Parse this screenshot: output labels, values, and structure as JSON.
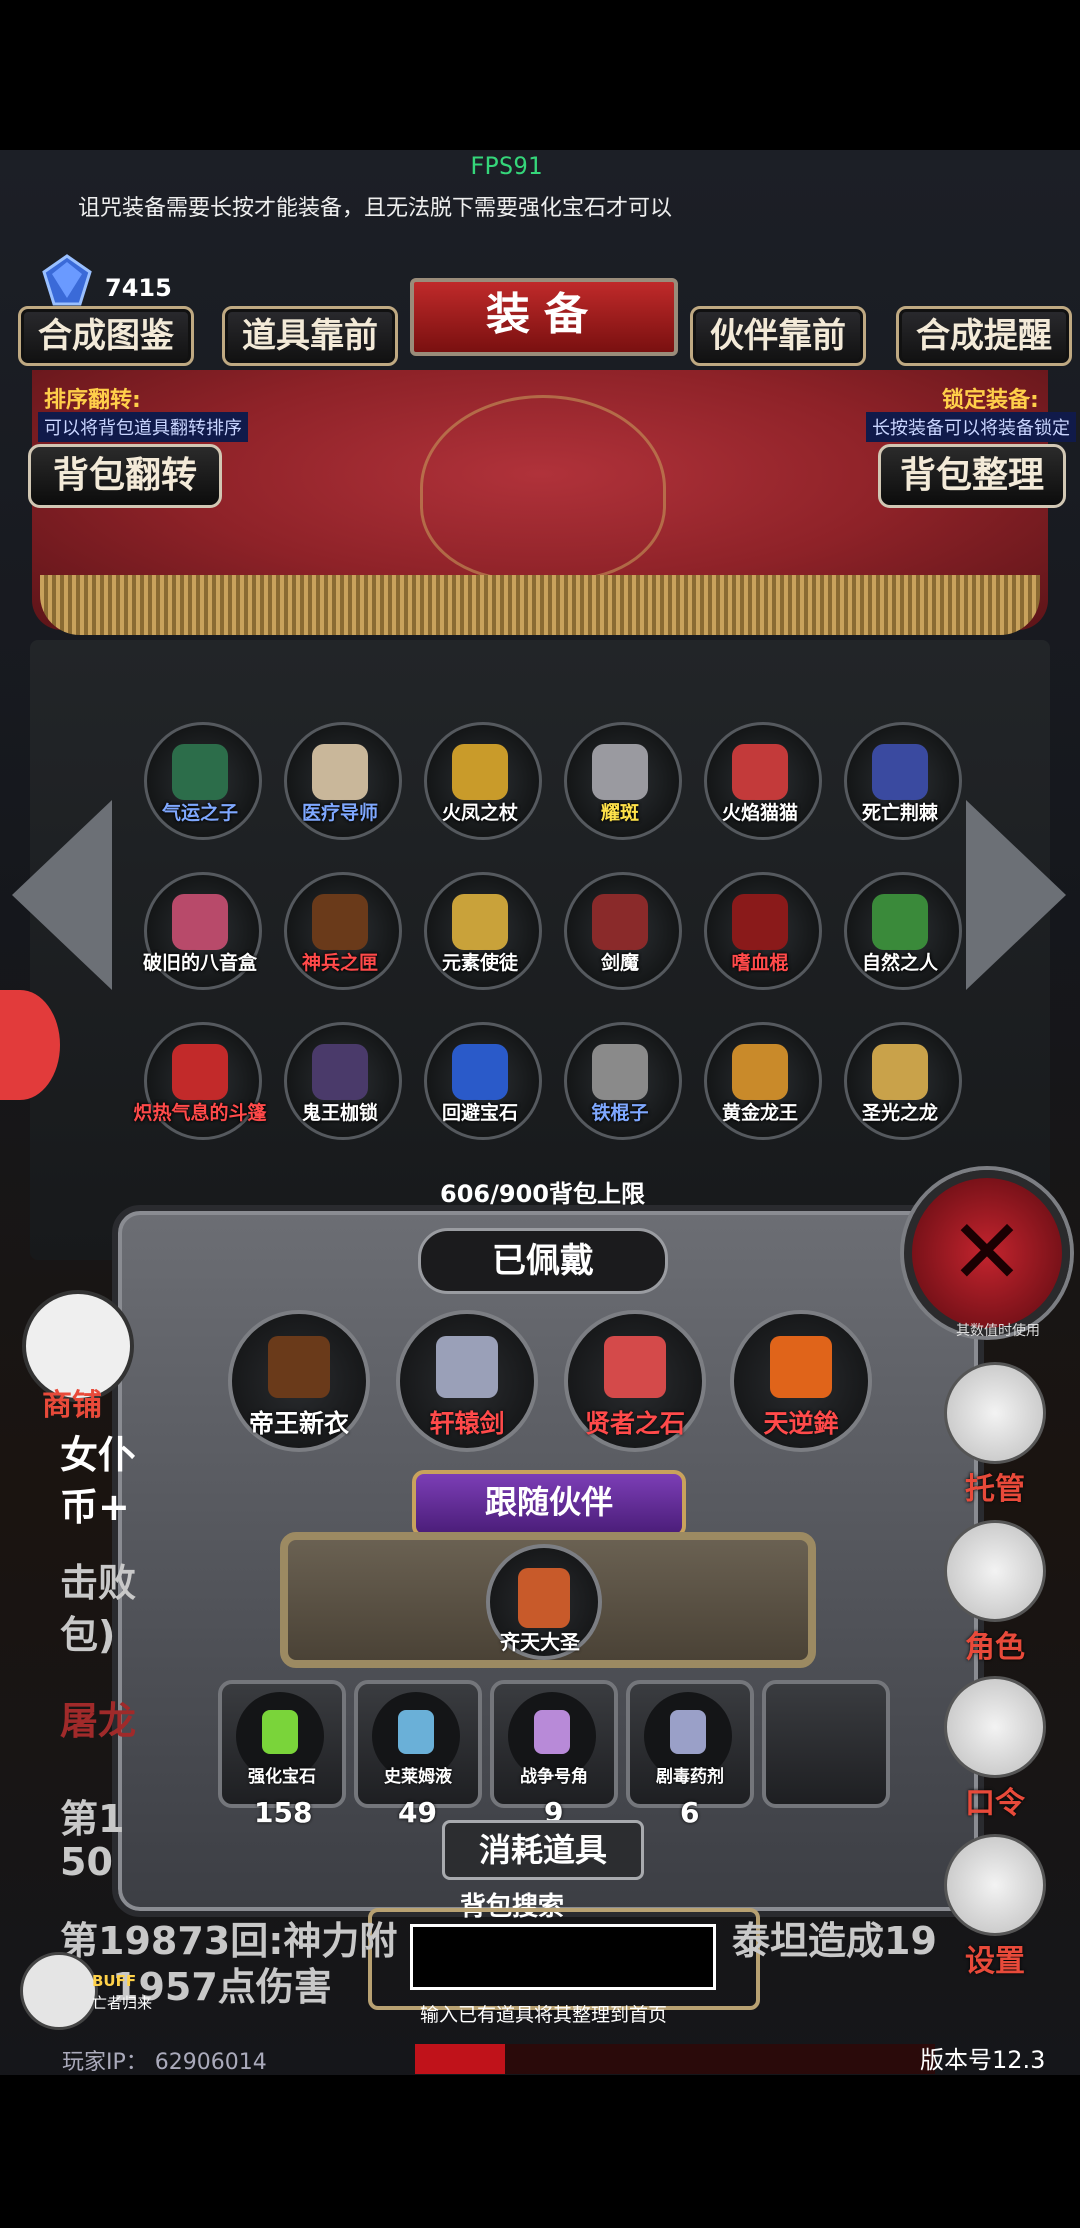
{
  "hud": {
    "fps": "FPS91",
    "tip": "诅咒装备需要长按才能装备，且无法脱下需要强化宝石才可以",
    "gems": "7415"
  },
  "top_buttons": [
    "合成图鉴",
    "道具靠前",
    "伙伴靠前",
    "合成提醒"
  ],
  "title": "装备",
  "left_side": {
    "label": "排序翻转:",
    "desc": "可以将背包道具翻转排序",
    "button": "背包翻转"
  },
  "right_side": {
    "label": "锁定装备:",
    "desc": "长按装备可以将装备锁定",
    "button": "背包整理"
  },
  "items": [
    {
      "label": "气运之子",
      "color": "#7fa8ff",
      "icon": "#2c6d4a"
    },
    {
      "label": "医疗导师",
      "color": "#7fa8ff",
      "icon": "#c9b79a"
    },
    {
      "label": "火凤之杖",
      "color": "#ffffff",
      "icon": "#c99b2a"
    },
    {
      "label": "耀斑",
      "color": "#ffe24a",
      "icon": "#9a9aa0"
    },
    {
      "label": "火焰猫猫",
      "color": "#ffffff",
      "icon": "#c33a3a"
    },
    {
      "label": "死亡荆棘",
      "color": "#ffffff",
      "icon": "#3a4aa0"
    },
    {
      "label": "破旧的八音盒",
      "color": "#ffffff",
      "icon": "#b84a6a"
    },
    {
      "label": "神兵之匣",
      "color": "#ff4a4a",
      "icon": "#6a3a1a"
    },
    {
      "label": "元素使徒",
      "color": "#ffffff",
      "icon": "#c9a23a"
    },
    {
      "label": "剑魔",
      "color": "#ffffff",
      "icon": "#8a2a2a"
    },
    {
      "label": "嗜血棍",
      "color": "#ff4a4a",
      "icon": "#8a1a1a"
    },
    {
      "label": "自然之人",
      "color": "#ffffff",
      "icon": "#3a8a3a"
    },
    {
      "label": "炽热气息的斗篷",
      "color": "#ff4a4a",
      "icon": "#c22a2a"
    },
    {
      "label": "鬼王枷锁",
      "color": "#ffffff",
      "icon": "#4a3a6a"
    },
    {
      "label": "回避宝石",
      "color": "#ffffff",
      "icon": "#2a5ac9"
    },
    {
      "label": "铁棍子",
      "color": "#7fa8ff",
      "icon": "#8a8a8a"
    },
    {
      "label": "黄金龙王",
      "color": "#ffffff",
      "icon": "#c98a2a"
    },
    {
      "label": "圣光之龙",
      "color": "#ffffff",
      "icon": "#c9a24a"
    }
  ],
  "capacity": "606/900背包上限",
  "equipped": {
    "title": "已佩戴",
    "items": [
      {
        "label": "帝王新衣",
        "color": "#ffffff",
        "icon": "#6a3a1a"
      },
      {
        "label": "轩辕剑",
        "color": "#ff4a4a",
        "icon": "#9aa0b8"
      },
      {
        "label": "贤者之石",
        "color": "#ff4a4a",
        "icon": "#d44a4a"
      },
      {
        "label": "天逆鉾",
        "color": "#ff4a4a",
        "icon": "#e0641a"
      }
    ]
  },
  "follow": {
    "title": "跟随伙伴",
    "name": "齐天大圣"
  },
  "consumables": {
    "title": "消耗道具",
    "items": [
      {
        "label": "强化宝石",
        "count": "158",
        "icon": "#7ad43a"
      },
      {
        "label": "史莱姆液",
        "count": "49",
        "icon": "#6ab0d8"
      },
      {
        "label": "战争号角",
        "count": "9",
        "icon": "#b88ad8"
      },
      {
        "label": "剧毒药剂",
        "count": "6",
        "icon": "#9aa0c8"
      }
    ]
  },
  "search": {
    "label": "背包搜索",
    "hint": "输入已有道具将其整理到首页"
  },
  "log": [
    "女仆",
    "币+",
    "击败",
    "包)",
    "屠龙",
    "第1",
    "50",
    "第19873回:神力附",
    "泰坦造成19",
    "1957点伤害"
  ],
  "side_menu": {
    "shop": "商铺",
    "manage": "托管",
    "role": "角色",
    "code": "口令",
    "settings": "设置",
    "small_note": "其数值时使用"
  },
  "buff": {
    "label": "BUFF",
    "sub": "亡者归来"
  },
  "footer": {
    "ip": "玩家IP： 62906014",
    "version": "版本号12.3"
  }
}
